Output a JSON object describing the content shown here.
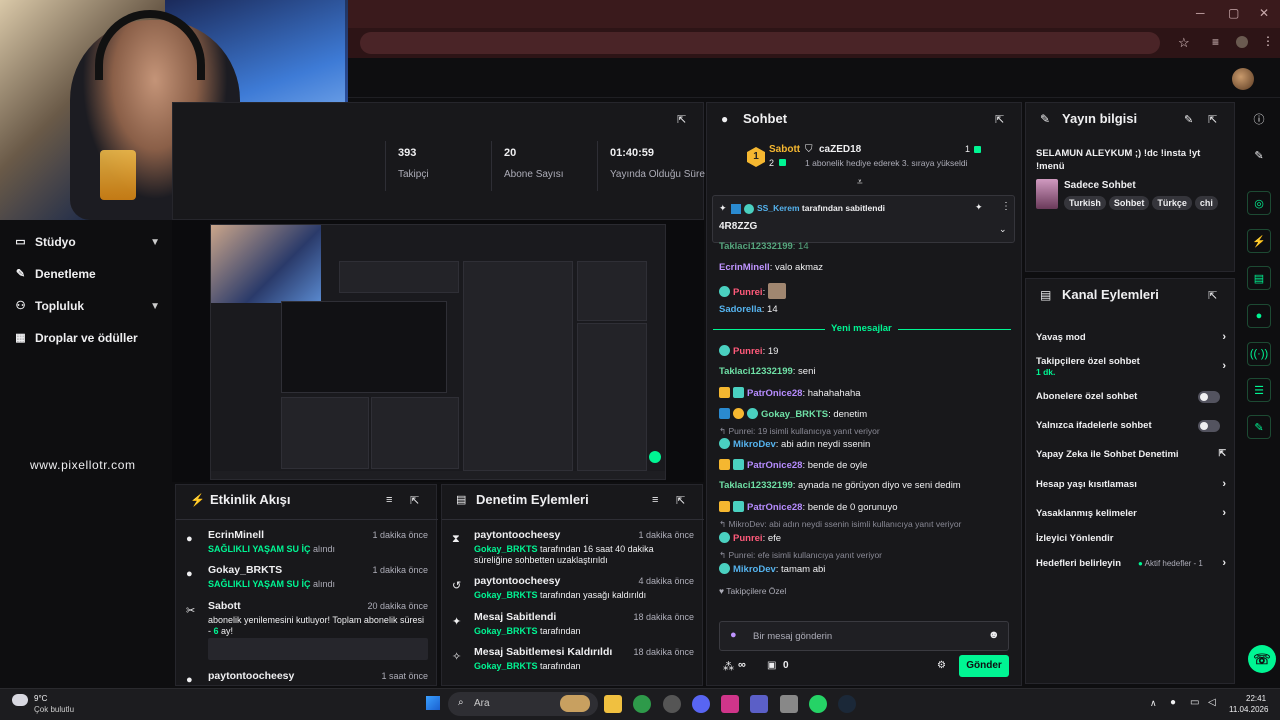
{
  "stats": {
    "followers_value": "393",
    "followers_label": "Takipçi",
    "subs_value": "20",
    "subs_label": "Abone Sayısı",
    "live_value": "01:40:59",
    "live_label": "Yayında Olduğu Süre"
  },
  "sidebar": {
    "items": [
      {
        "label": "Stüdyo",
        "icon": "studio-icon"
      },
      {
        "label": "Denetleme",
        "icon": "wrench-icon"
      },
      {
        "label": "Topluluk",
        "icon": "people-icon"
      },
      {
        "label": "Droplar ve ödüller",
        "icon": "gift-icon"
      }
    ],
    "watermark": "www.pixellotr.com"
  },
  "activity": {
    "title": "Etkinlik Akışı",
    "items": [
      {
        "name": "EcrinMinell",
        "time": "1 dakika önce",
        "highlight": "SAĞLIKLI YAŞAM SU İÇ",
        "suffix": " alındı"
      },
      {
        "name": "Gokay_BRKTS",
        "time": "1 dakika önce",
        "highlight": "SAĞLIKLI YAŞAM SU İÇ",
        "suffix": " alındı"
      },
      {
        "name": "Sabott",
        "time": "20 dakika önce",
        "text": "abonelik yenilemesini kutluyor! Toplam abonelik süresi -",
        "months": "6",
        "text2": "ay!"
      },
      {
        "name": "paytontoocheesy",
        "time": "1 saat önce"
      }
    ]
  },
  "moderation": {
    "title": "Denetim Eylemleri",
    "items": [
      {
        "name": "paytontoocheesy",
        "time": "1 dakika önce",
        "actor": "Gokay_BRKTS",
        "text": " tarafından 16 saat 40 dakika süreliğine sohbetten uzaklaştırıldı"
      },
      {
        "name": "paytontoocheesy",
        "time": "4 dakika önce",
        "actor": "Gokay_BRKTS",
        "text": " tarafından yasağı kaldırıldı"
      },
      {
        "name": "Mesaj Sabitlendi",
        "time": "18 dakika önce",
        "actor": "Gokay_BRKTS",
        "text": " tarafından"
      },
      {
        "name": "Mesaj Sabitlemesi Kaldırıldı",
        "time": "18 dakika önce",
        "actor": "Gokay_BRKTS",
        "text": " tarafından"
      }
    ]
  },
  "chat": {
    "title": "Sohbet",
    "top_gifter": "Sabott",
    "top_gifter_count": "2",
    "gifter2": "caZED18",
    "gifter2_count": "1",
    "gifter2_text": "1 abonelik hediye ederek 3. sıraya yükseldi",
    "pinned_by": "SS_Kerem",
    "pinned_by_text": " tarafından sabitlendi",
    "pinned_msg": "4R8ZZG",
    "new_messages": "Yeni mesajlar",
    "messages": [
      {
        "user": "Taklaci12332199",
        "text": ": 14"
      },
      {
        "user": "EcrinMinell",
        "text": ": valo akmaz"
      },
      {
        "user": "Punrei",
        "text": ":"
      },
      {
        "user": "Sadorella",
        "text": ": 14"
      },
      {
        "user": "Punrei",
        "text": ": 19"
      },
      {
        "user": "Taklaci12332199",
        "text": ": seni"
      },
      {
        "user": "PatrOnice28",
        "text": ": hahahahaha"
      },
      {
        "user": "Gokay_BRKTS",
        "text": ": denetim"
      },
      {
        "reply": "Punrei: 19 isimli kullanıcıya yanıt veriyor"
      },
      {
        "user": "MikroDev",
        "text": ": abi adın neydi ssenin"
      },
      {
        "user": "PatrOnice28",
        "text": ": bende de oyle"
      },
      {
        "user": "Taklaci12332199",
        "text": ": aynada ne görüyon diyo ve seni dedim"
      },
      {
        "user": "PatrOnice28",
        "text": ": bende de 0 gorunuyo"
      },
      {
        "reply": "MikroDev: abi adın neydi ssenin isimli kullanıcıya yanıt veriyor"
      },
      {
        "user": "Punrei",
        "text": ": efe"
      },
      {
        "reply": "Punrei: efe isimli kullanıcıya yanıt veriyor"
      },
      {
        "user": "MikroDev",
        "text": ": tamam abi"
      }
    ],
    "followers_only": "Takipçilere Özel",
    "input_placeholder": "Bir mesaj gönderin",
    "points": "∞",
    "drops": "0",
    "send": "Gönder"
  },
  "info": {
    "title": "Yayın bilgisi",
    "stream_title": "SELAMUN ALEYKUM ;) !dc !insta !yt !menü",
    "category": "Sadece Sohbet",
    "tags": [
      "Turkish",
      "Sohbet",
      "Türkçe",
      "chi"
    ]
  },
  "kanal": {
    "title": "Kanal Eylemleri",
    "items": [
      {
        "label": "Yavaş mod",
        "type": "chevron"
      },
      {
        "label": "Takipçilere özel sohbet",
        "sub": "1 dk.",
        "type": "chevron"
      },
      {
        "label": "Abonelere özel sohbet",
        "type": "toggle"
      },
      {
        "label": "Yalnızca ifadelerle sohbet",
        "type": "toggle"
      },
      {
        "label": "Yapay Zeka ile Sohbet Denetimi",
        "type": "external"
      },
      {
        "label": "Hesap yaşı kısıtlaması",
        "type": "chevron"
      },
      {
        "label": "Yasaklanmış kelimeler",
        "type": "chevron"
      },
      {
        "label": "İzleyici Yönlendir",
        "type": "none"
      },
      {
        "label": "Hedefleri belirleyin",
        "status": "Aktif hedefler - 1",
        "type": "chevron"
      }
    ]
  },
  "taskbar": {
    "weather_temp": "9°C",
    "weather_desc": "Çok bulutlu",
    "search": "Ara",
    "time": "22:41",
    "date": "11.04.2026"
  },
  "colors": {
    "accent": "#00f593",
    "bg": "#18181b",
    "tab_bar": "#3a1a1c"
  }
}
